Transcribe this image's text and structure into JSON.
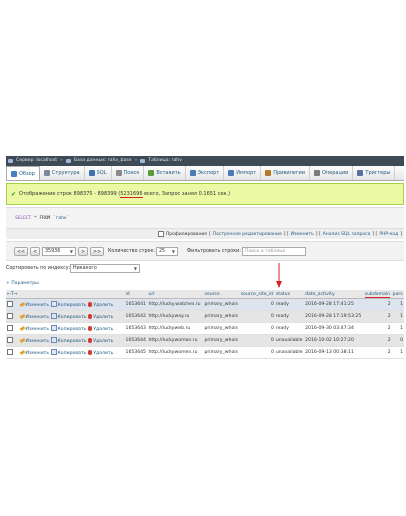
{
  "breadcrumb": {
    "items": [
      "Сервер: localhost",
      "База данных: rahv_base",
      "Таблица: rahv"
    ]
  },
  "tabs": [
    {
      "label": "Обзор",
      "icon": "browse-icon",
      "color": "#4a7fbf",
      "active": true
    },
    {
      "label": "Структура",
      "icon": "structure-icon",
      "color": "#7d8a99",
      "active": false
    },
    {
      "label": "SQL",
      "icon": "sql-icon",
      "color": "#3e6fb0",
      "active": false
    },
    {
      "label": "Поиск",
      "icon": "search-icon",
      "color": "#8a8a8a",
      "active": false
    },
    {
      "label": "Вставить",
      "icon": "insert-icon",
      "color": "#5a9c3b",
      "active": false
    },
    {
      "label": "Экспорт",
      "icon": "export-icon",
      "color": "#4d7bb6",
      "active": false
    },
    {
      "label": "Импорт",
      "icon": "import-icon",
      "color": "#4d7bb6",
      "active": false
    },
    {
      "label": "Привилегии",
      "icon": "privileges-icon",
      "color": "#b9772a",
      "active": false
    },
    {
      "label": "Операции",
      "icon": "operations-icon",
      "color": "#7a7a7a",
      "active": false
    },
    {
      "label": "Триггеры",
      "icon": "triggers-icon",
      "color": "#5a6fa0",
      "active": false
    }
  ],
  "message": {
    "before": "Отображение строк 898375 - 898399 (",
    "total": "5231696",
    "after": " всего, Запрос занял 0.1651 сек.)"
  },
  "sql": {
    "keyword": "SELECT",
    "rest": "* FROM",
    "table": "`rahv`"
  },
  "options": {
    "profiling": "Профилирование",
    "links": [
      "Построчное редактирование",
      "Изменить",
      "Анализ SQL запроса",
      "PHP-код"
    ]
  },
  "nav": {
    "first": "<<",
    "prev": "<",
    "page": "35936",
    "next": ">",
    "last": ">>",
    "rows_label": "Количество строк:",
    "rows_value": "25",
    "filter_label": "Фильтровать строки:",
    "filter_placeholder": "Поиск в таблице"
  },
  "sort": {
    "label": "Сортировать по индексу:",
    "value": "Никакого"
  },
  "params": {
    "label": "+ Параметры",
    "arrows": "←T→"
  },
  "table": {
    "headers": [
      "",
      "",
      "id",
      "url",
      "source",
      "source_site_id",
      "status",
      "date_activity",
      "subdomain",
      "pars"
    ],
    "actions": {
      "edit": "Изменить",
      "copy": "Копировать",
      "delete": "Удалить"
    },
    "rows": [
      [
        "1653641",
        "http://lucky.watches.ru",
        "primary_whois",
        "0",
        "ready",
        "2016-09-28 17:41:25",
        "2",
        "1"
      ],
      [
        "1653642",
        "http://luckyway.ru",
        "primary_whois",
        "0",
        "ready",
        "2016-09-28 17:19:53:25",
        "2",
        "1"
      ],
      [
        "1653643",
        "http://luckyweb.ru",
        "primary_whois",
        "0",
        "ready",
        "2016-09-30 03:47:34",
        "2",
        "1"
      ],
      [
        "1653644",
        "http://luckywoman.ru",
        "primary_whois",
        "0",
        "unavailable",
        "2016-10-02 10:27:20",
        "2",
        "0"
      ],
      [
        "1653645",
        "http://luckywomen.ru",
        "primary_whois",
        "0",
        "unavailable",
        "2016-09-13 00:38:11",
        "2",
        "1"
      ]
    ]
  },
  "colors": {
    "accent": "#235a81",
    "success_bg": "#ebf8a4",
    "success_border": "#a2d246",
    "highlight": "#d8202a"
  }
}
